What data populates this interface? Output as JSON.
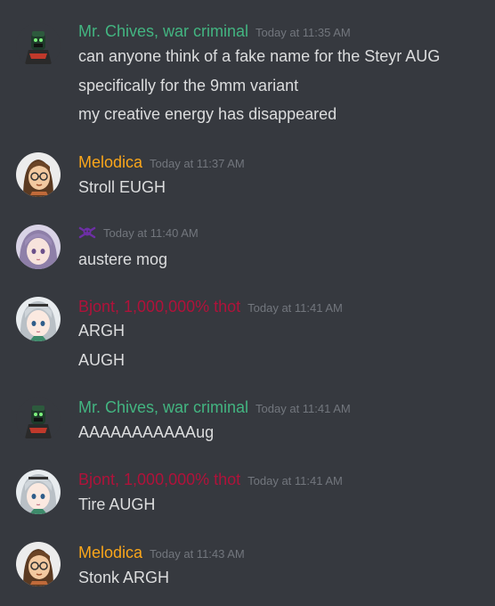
{
  "colors": {
    "background": "#36393f",
    "text": "#dcddde",
    "timestamp": "#72767d",
    "chives": "#43b581",
    "melodica": "#faa61a",
    "bjont": "#b0123a",
    "purple_icon": "#6d2fa5"
  },
  "messages": [
    {
      "author": "Mr. Chives, war criminal",
      "author_color": "#43b581",
      "avatar": "soldier-avatar",
      "timestamp": "Today at 11:35 AM",
      "lines": [
        "can anyone think of a fake name for the Steyr AUG",
        "specifically for the 9mm variant",
        "my creative energy has disappeared"
      ]
    },
    {
      "author": "Melodica",
      "author_color": "#faa61a",
      "avatar": "glasses-girl-avatar",
      "timestamp": "Today at 11:37 AM",
      "lines": [
        "Stroll EUGH"
      ]
    },
    {
      "author": "",
      "author_icon": "skull-crossbones-icon",
      "avatar": "purple-hair-avatar",
      "timestamp": "Today at 11:40 AM",
      "lines": [
        "austere mog"
      ]
    },
    {
      "author": "Bjont, 1,000,000% thot",
      "author_color": "#b0123a",
      "avatar": "silver-hair-avatar",
      "timestamp": "Today at 11:41 AM",
      "lines": [
        "ARGH",
        "AUGH"
      ]
    },
    {
      "author": "Mr. Chives, war criminal",
      "author_color": "#43b581",
      "avatar": "soldier-avatar",
      "timestamp": "Today at 11:41 AM",
      "lines": [
        "AAAAAAAAAAAug"
      ]
    },
    {
      "author": "Bjont, 1,000,000% thot",
      "author_color": "#b0123a",
      "avatar": "silver-hair-avatar",
      "timestamp": "Today at 11:41 AM",
      "lines": [
        "Tire AUGH"
      ]
    },
    {
      "author": "Melodica",
      "author_color": "#faa61a",
      "avatar": "glasses-girl-avatar",
      "timestamp": "Today at 11:43 AM",
      "lines": [
        "Stonk ARGH"
      ]
    }
  ]
}
